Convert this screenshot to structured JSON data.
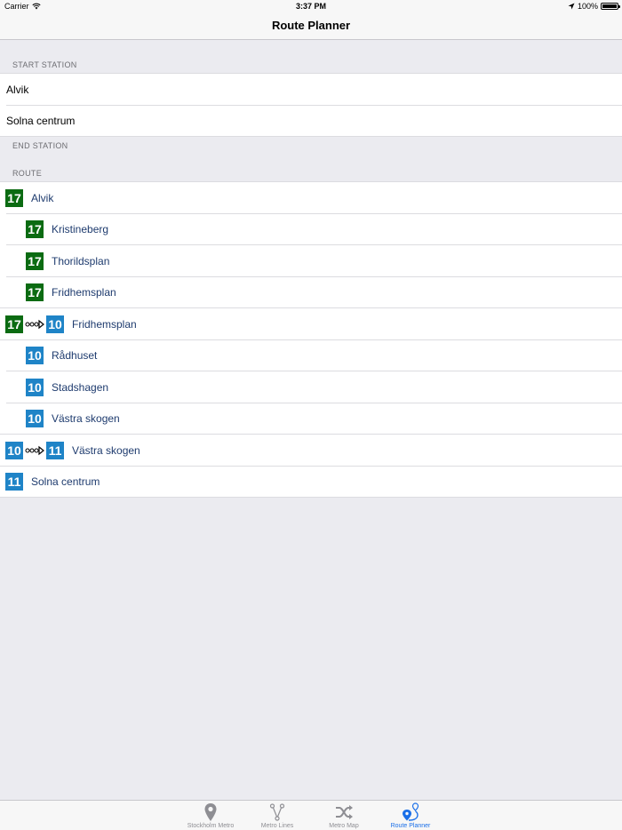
{
  "status_bar": {
    "carrier": "Carrier",
    "time": "3:37 PM",
    "battery": "100%"
  },
  "nav": {
    "title": "Route Planner"
  },
  "sections": {
    "start_header": "START STATION",
    "end_header": "END STATION",
    "route_header": "ROUTE"
  },
  "start_group": {
    "items": [
      "Alvik",
      "Solna centrum"
    ]
  },
  "route": {
    "rows": [
      {
        "line": "17",
        "color": "green",
        "station": "Alvik",
        "indent": false
      },
      {
        "line": "17",
        "color": "green",
        "station": "Kristineberg",
        "indent": true
      },
      {
        "line": "17",
        "color": "green",
        "station": "Thorildsplan",
        "indent": true
      },
      {
        "line": "17",
        "color": "green",
        "station": "Fridhemsplan",
        "indent": true
      },
      {
        "line": "17",
        "color": "green",
        "to_line": "10",
        "to_color": "blue",
        "station": "Fridhemsplan",
        "transfer": true
      },
      {
        "line": "10",
        "color": "blue",
        "station": "Rådhuset",
        "indent": true
      },
      {
        "line": "10",
        "color": "blue",
        "station": "Stadshagen",
        "indent": true
      },
      {
        "line": "10",
        "color": "blue",
        "station": "Västra skogen",
        "indent": true
      },
      {
        "line": "10",
        "color": "blue",
        "to_line": "11",
        "to_color": "blue",
        "station": "Västra skogen",
        "transfer": true
      },
      {
        "line": "11",
        "color": "blue",
        "station": "Solna centrum",
        "indent": false
      }
    ]
  },
  "colors": {
    "green_line": "#0b6b12",
    "blue_line": "#1f84c7",
    "tab_active": "#1a6fe8",
    "tab_inactive": "#8e8e93"
  },
  "tabs": [
    {
      "label": "Stockholm Metro",
      "icon": "map-pin-icon"
    },
    {
      "label": "Metro Lines",
      "icon": "branch-lines-icon"
    },
    {
      "label": "Metro Map",
      "icon": "shuffle-icon"
    },
    {
      "label": "Route Planner",
      "icon": "route-pin-icon",
      "active": true
    }
  ]
}
